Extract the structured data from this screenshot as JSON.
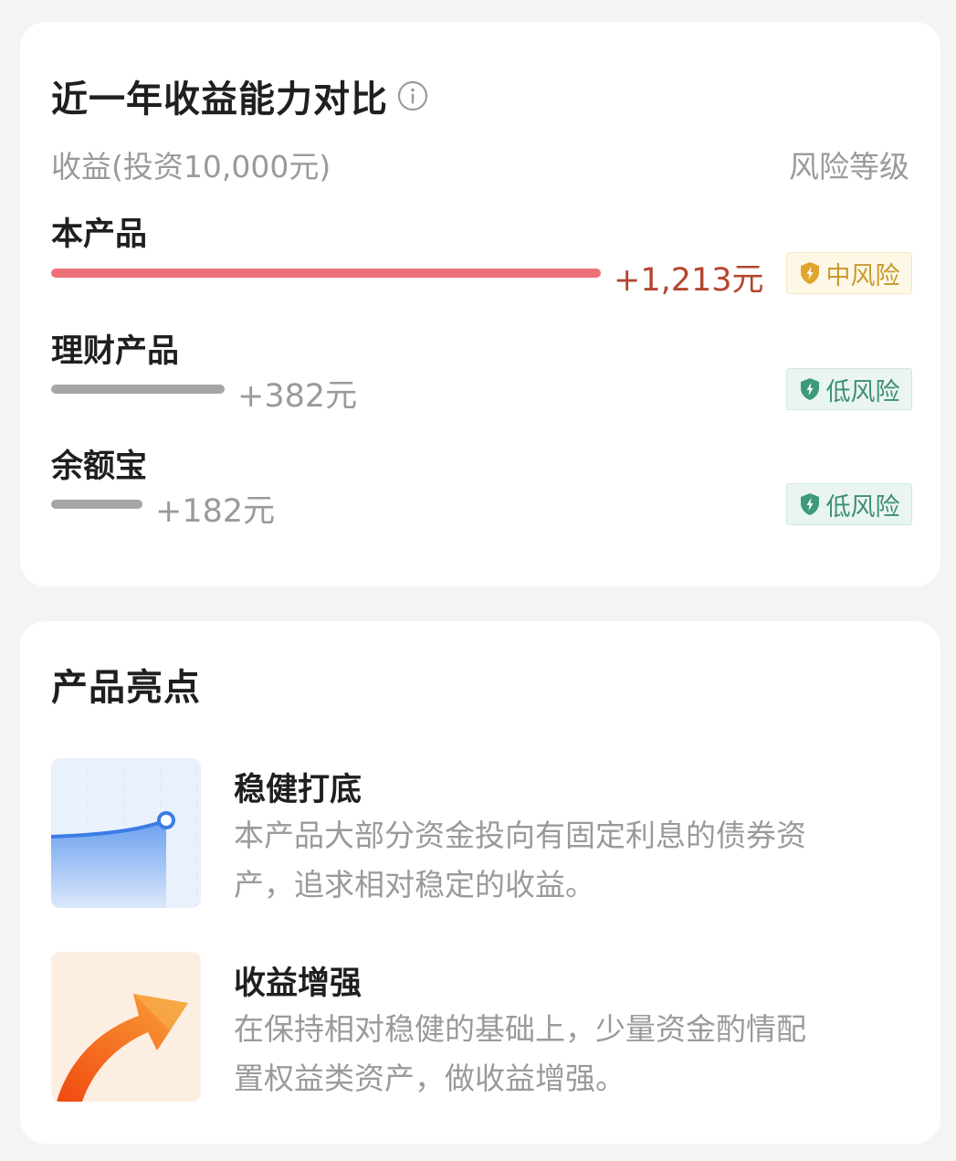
{
  "comparison": {
    "title": "近一年收益能力对比",
    "info_icon": "info-circle-icon",
    "header_left": "收益(投资10,000元)",
    "header_right": "风险等级",
    "rows": [
      {
        "name": "本产品",
        "amount": "+1,213元",
        "value": 1213,
        "risk": "中风险",
        "risk_icon": "shield-bolt-icon",
        "bar_color": "#ec7178",
        "badge_color": "#c79a2e"
      },
      {
        "name": "理财产品",
        "amount": "+382元",
        "value": 382,
        "risk": "低风险",
        "risk_icon": "shield-bolt-icon",
        "bar_color": "#a6a6a6",
        "badge_color": "#3d8f72"
      },
      {
        "name": "余额宝",
        "amount": "+182元",
        "value": 182,
        "risk": "低风险",
        "risk_icon": "shield-bolt-icon",
        "bar_color": "#a6a6a6",
        "badge_color": "#3d8f72"
      }
    ]
  },
  "highlights": {
    "title": "产品亮点",
    "items": [
      {
        "icon": "rising-line-chart-icon",
        "name": "稳健打底",
        "desc": [
          "本产品大部分资金投向有固定利息的债券资",
          "产，追求相对稳定的收益。"
        ]
      },
      {
        "icon": "orange-up-arrow-icon",
        "name": "收益增强",
        "desc": [
          "在保持相对稳健的基础上，少量资金酌情配",
          "置权益类资产，做收益增强。"
        ]
      }
    ]
  }
}
